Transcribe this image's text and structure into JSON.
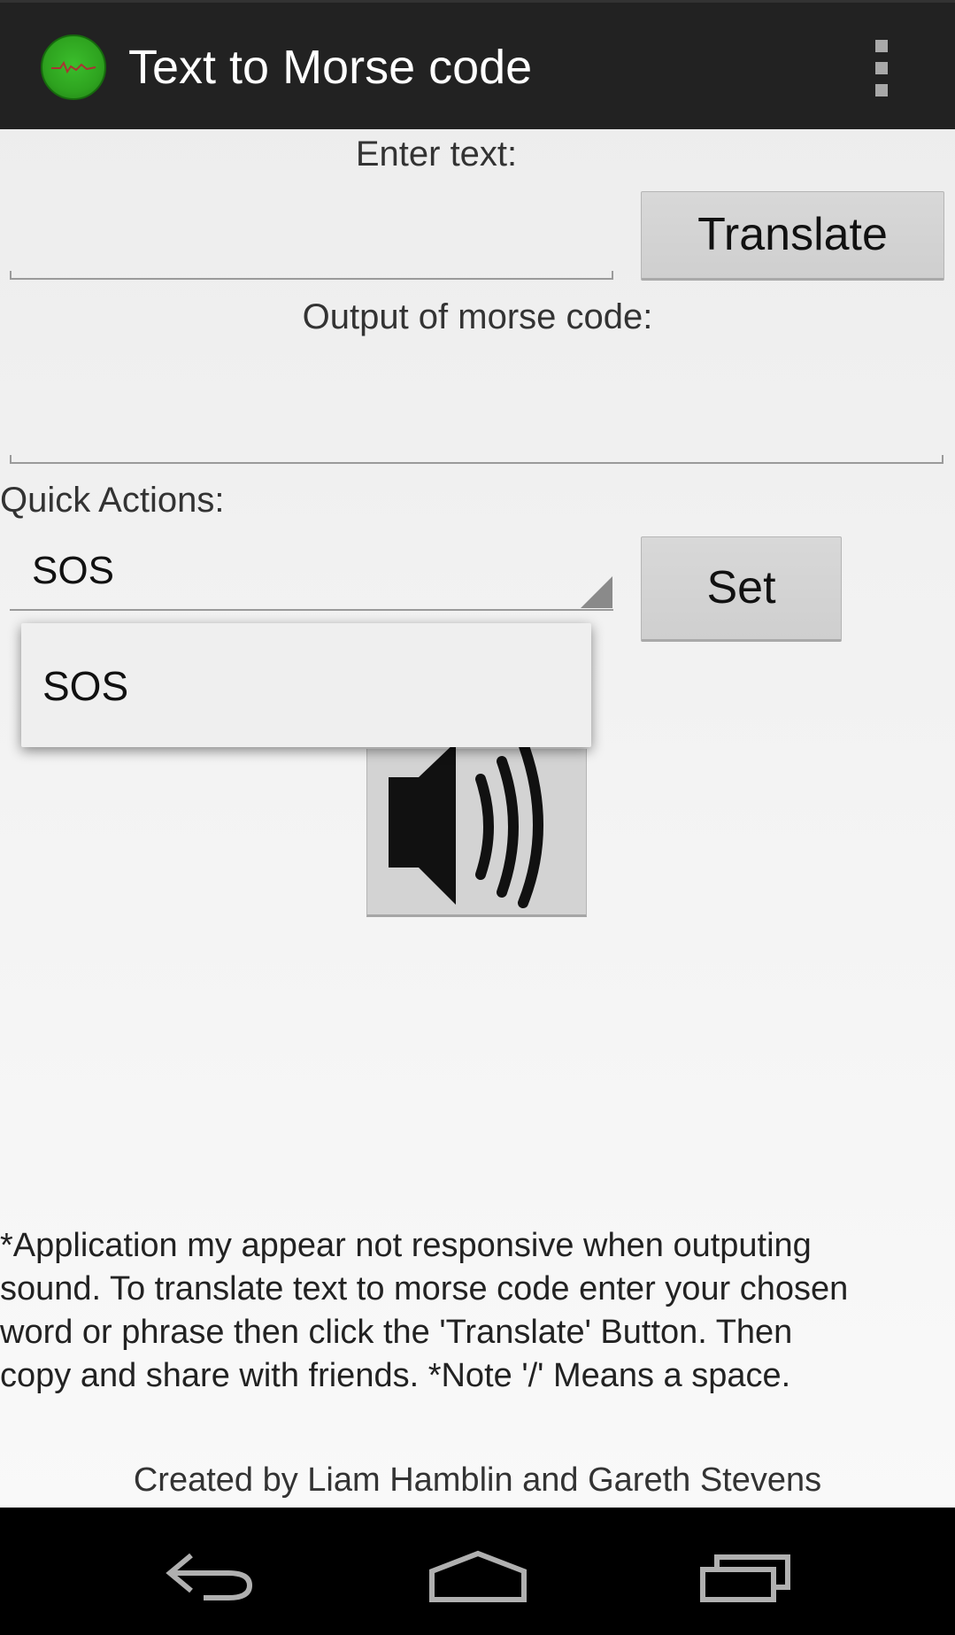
{
  "action_bar": {
    "title": "Text to Morse code",
    "app_icon": "app-logo-icon",
    "overflow_icon": "overflow-menu-icon"
  },
  "main": {
    "enter_text_label": "Enter text:",
    "text_input_value": "",
    "translate_button": "Translate",
    "output_label": "Output of morse code:",
    "output_value": "",
    "quick_actions_label": "Quick Actions:",
    "quick_action_selected": "SOS",
    "quick_action_options": [
      "SOS"
    ],
    "set_button": "Set",
    "play_sound_icon": "speaker-icon"
  },
  "footer": {
    "info_text": "*Application my appear not responsive when outputing\nsound. To translate text to morse code enter your chosen\nword or phrase then click the 'Translate' Button. Then\ncopy and share with friends. *Note '/' Means a space.",
    "credits": "Created by Liam Hamblin and Gareth Stevens"
  },
  "nav_bar": {
    "back_icon": "back-icon",
    "home_icon": "home-icon",
    "recents_icon": "recents-icon"
  },
  "colors": {
    "action_bar": "#222222",
    "app_icon_green": "#2ea31f",
    "button_gray": "#d3d3d3",
    "nav_bar": "#000000"
  }
}
